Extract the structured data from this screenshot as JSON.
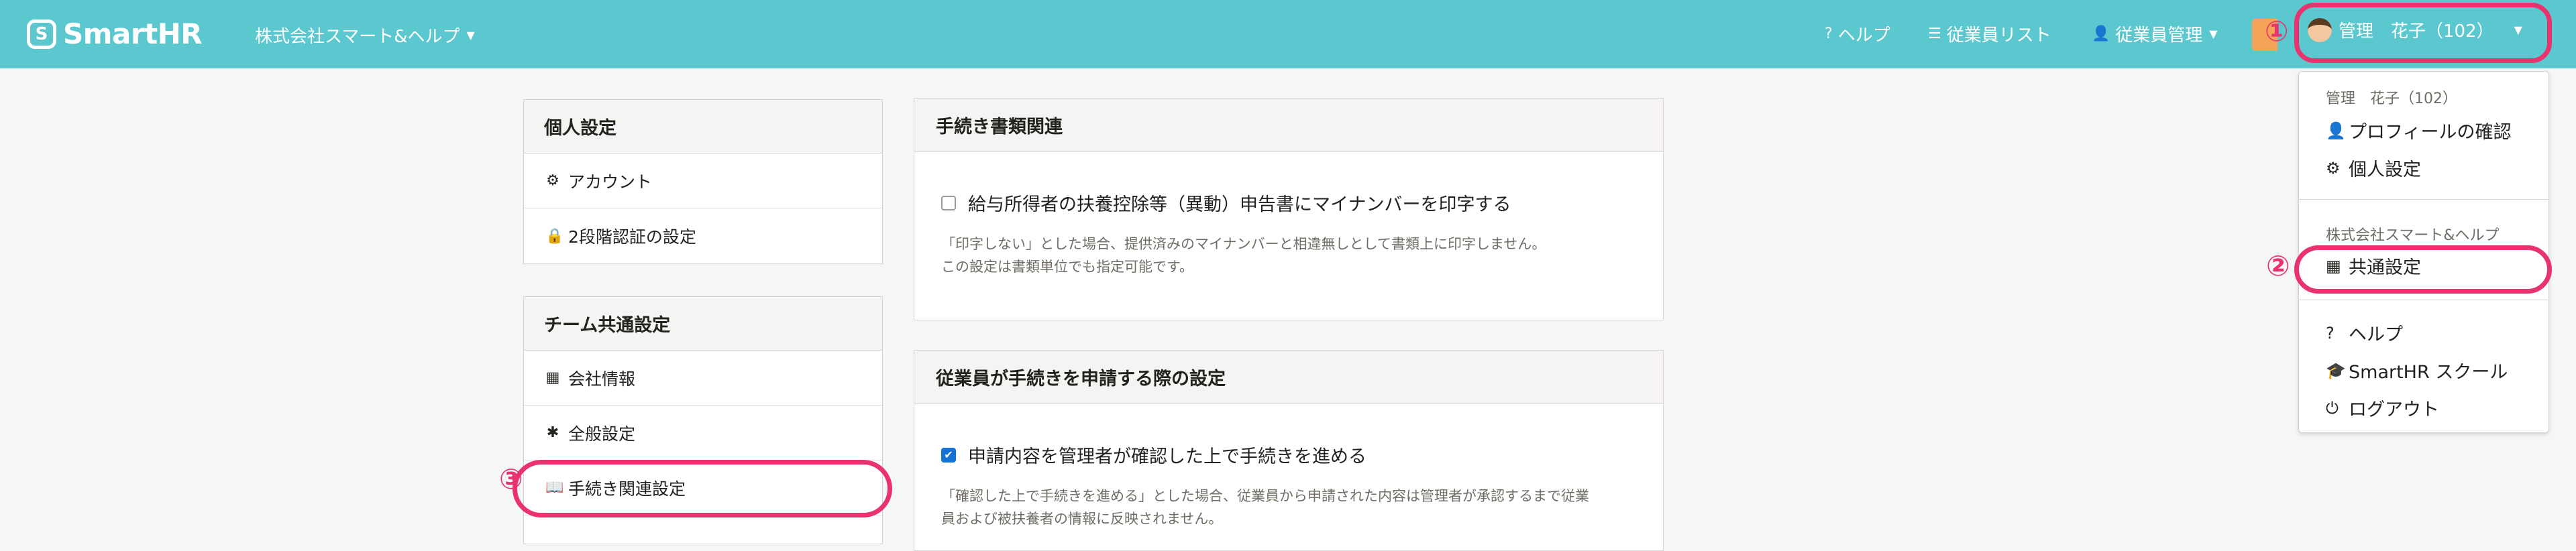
{
  "header": {
    "logo_glyph": "S",
    "logo_text": "SmartHR",
    "company": "株式会社スマート&ヘルプ",
    "nav": [
      {
        "icon": "help-circle-icon",
        "glyph": "?",
        "label": "ヘルプ"
      },
      {
        "icon": "list-icon",
        "glyph": "☰",
        "label": "従業員リスト"
      },
      {
        "icon": "user-icon",
        "glyph": "👤",
        "label": "従業員管理"
      }
    ],
    "user_name": "管理　花子（102）",
    "accent_color": "#5bc8d0"
  },
  "annotations": {
    "one": "①",
    "two": "②",
    "three": "③",
    "color": "#e8336f"
  },
  "dropdown": {
    "user_header": "管理　花子（102）",
    "profile": "プロフィールの確認",
    "personal": "個人設定",
    "company_header": "株式会社スマート&ヘルプ",
    "common_settings": "共通設定",
    "help": "ヘルプ",
    "school": "SmartHR スクール",
    "logout": "ログアウト"
  },
  "sidebar": {
    "personal_title": "個人設定",
    "personal_items": [
      {
        "icon": "gear-icon",
        "glyph": "⚙",
        "label": "アカウント"
      },
      {
        "icon": "lock-icon",
        "glyph": "🔒",
        "label": "2段階認証の設定"
      }
    ],
    "team_title": "チーム共通設定",
    "team_items": [
      {
        "icon": "building-icon",
        "glyph": "▦",
        "label": "会社情報"
      },
      {
        "icon": "asterisk-icon",
        "glyph": "✱",
        "label": "全般設定"
      },
      {
        "icon": "book-icon",
        "glyph": "📖",
        "label": "手続き関連設定"
      }
    ]
  },
  "main": {
    "docs_card": {
      "title": "手続き書類関連",
      "checkbox_label": "給与所得者の扶養控除等（異動）申告書にマイナンバーを印字する",
      "checked": false,
      "note_line1": "「印字しない」とした場合、提供済みのマイナンバーと相違無しとして書類上に印字しません。",
      "note_line2": "この設定は書類単位でも指定可能です。"
    },
    "apply_card": {
      "title": "従業員が手続きを申請する際の設定",
      "checkbox_label": "申請内容を管理者が確認した上で手続きを進める",
      "checked": true,
      "note_line1": "「確認した上で手続きを進める」とした場合、従業員から申請された内容は管理者が承認するまで従業",
      "note_line2": "員および被扶養者の情報に反映されません。"
    }
  }
}
